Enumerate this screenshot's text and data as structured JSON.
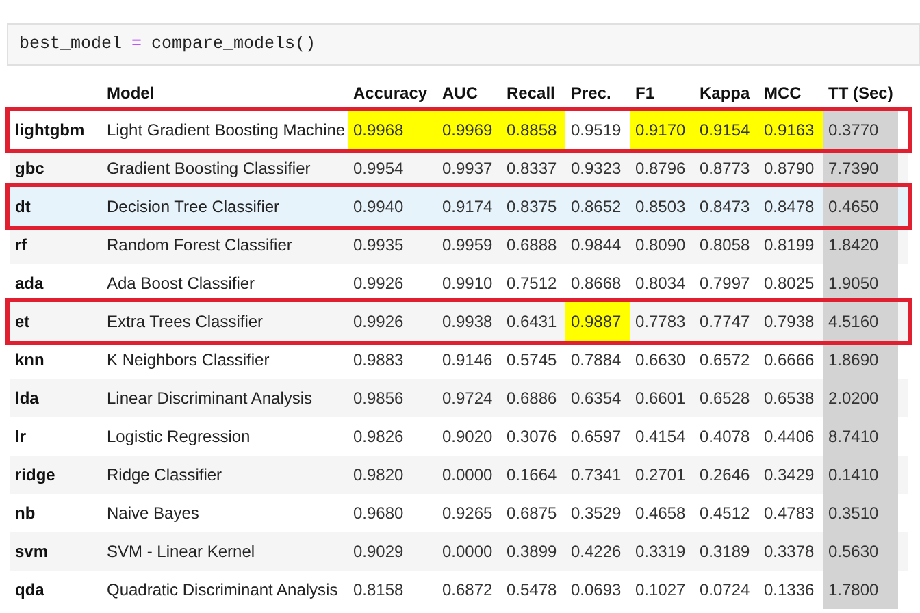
{
  "code_cell": {
    "tokens": [
      {
        "text": "best_model",
        "kind": "name"
      },
      {
        "text": "=",
        "kind": "operator"
      },
      {
        "text": "compare_models()",
        "kind": "name"
      }
    ]
  },
  "table": {
    "columns": [
      "",
      "Model",
      "Accuracy",
      "AUC",
      "Recall",
      "Prec.",
      "F1",
      "Kappa",
      "MCC",
      "TT (Sec)"
    ],
    "rows": [
      {
        "outlined": true,
        "hovered": false,
        "cells": [
          {
            "text": "lightgbm",
            "highlighted": false
          },
          {
            "text": "Light Gradient Boosting Machine",
            "highlighted": false
          },
          {
            "text": "0.9968",
            "highlighted": true
          },
          {
            "text": "0.9969",
            "highlighted": true
          },
          {
            "text": "0.8858",
            "highlighted": true
          },
          {
            "text": "0.9519",
            "highlighted": false
          },
          {
            "text": "0.9170",
            "highlighted": true
          },
          {
            "text": "0.9154",
            "highlighted": true
          },
          {
            "text": "0.9163",
            "highlighted": true
          },
          {
            "text": "0.3770",
            "highlighted": false
          }
        ]
      },
      {
        "outlined": false,
        "hovered": false,
        "cells": [
          {
            "text": "gbc",
            "highlighted": false
          },
          {
            "text": "Gradient Boosting Classifier",
            "highlighted": false
          },
          {
            "text": "0.9954",
            "highlighted": false
          },
          {
            "text": "0.9937",
            "highlighted": false
          },
          {
            "text": "0.8337",
            "highlighted": false
          },
          {
            "text": "0.9323",
            "highlighted": false
          },
          {
            "text": "0.8796",
            "highlighted": false
          },
          {
            "text": "0.8773",
            "highlighted": false
          },
          {
            "text": "0.8790",
            "highlighted": false
          },
          {
            "text": "7.7390",
            "highlighted": false
          }
        ]
      },
      {
        "outlined": true,
        "hovered": true,
        "cells": [
          {
            "text": "dt",
            "highlighted": false
          },
          {
            "text": "Decision Tree Classifier",
            "highlighted": false
          },
          {
            "text": "0.9940",
            "highlighted": false
          },
          {
            "text": "0.9174",
            "highlighted": false
          },
          {
            "text": "0.8375",
            "highlighted": false
          },
          {
            "text": "0.8652",
            "highlighted": false
          },
          {
            "text": "0.8503",
            "highlighted": false
          },
          {
            "text": "0.8473",
            "highlighted": false
          },
          {
            "text": "0.8478",
            "highlighted": false
          },
          {
            "text": "0.4650",
            "highlighted": false
          }
        ]
      },
      {
        "outlined": false,
        "hovered": false,
        "cells": [
          {
            "text": "rf",
            "highlighted": false
          },
          {
            "text": "Random Forest Classifier",
            "highlighted": false
          },
          {
            "text": "0.9935",
            "highlighted": false
          },
          {
            "text": "0.9959",
            "highlighted": false
          },
          {
            "text": "0.6888",
            "highlighted": false
          },
          {
            "text": "0.9844",
            "highlighted": false
          },
          {
            "text": "0.8090",
            "highlighted": false
          },
          {
            "text": "0.8058",
            "highlighted": false
          },
          {
            "text": "0.8199",
            "highlighted": false
          },
          {
            "text": "1.8420",
            "highlighted": false
          }
        ]
      },
      {
        "outlined": false,
        "hovered": false,
        "cells": [
          {
            "text": "ada",
            "highlighted": false
          },
          {
            "text": "Ada Boost Classifier",
            "highlighted": false
          },
          {
            "text": "0.9926",
            "highlighted": false
          },
          {
            "text": "0.9910",
            "highlighted": false
          },
          {
            "text": "0.7512",
            "highlighted": false
          },
          {
            "text": "0.8668",
            "highlighted": false
          },
          {
            "text": "0.8034",
            "highlighted": false
          },
          {
            "text": "0.7997",
            "highlighted": false
          },
          {
            "text": "0.8025",
            "highlighted": false
          },
          {
            "text": "1.9050",
            "highlighted": false
          }
        ]
      },
      {
        "outlined": true,
        "hovered": false,
        "cells": [
          {
            "text": "et",
            "highlighted": false
          },
          {
            "text": "Extra Trees Classifier",
            "highlighted": false
          },
          {
            "text": "0.9926",
            "highlighted": false
          },
          {
            "text": "0.9938",
            "highlighted": false
          },
          {
            "text": "0.6431",
            "highlighted": false
          },
          {
            "text": "0.9887",
            "highlighted": true
          },
          {
            "text": "0.7783",
            "highlighted": false
          },
          {
            "text": "0.7747",
            "highlighted": false
          },
          {
            "text": "0.7938",
            "highlighted": false
          },
          {
            "text": "4.5160",
            "highlighted": false
          }
        ]
      },
      {
        "outlined": false,
        "hovered": false,
        "cells": [
          {
            "text": "knn",
            "highlighted": false
          },
          {
            "text": "K Neighbors Classifier",
            "highlighted": false
          },
          {
            "text": "0.9883",
            "highlighted": false
          },
          {
            "text": "0.9146",
            "highlighted": false
          },
          {
            "text": "0.5745",
            "highlighted": false
          },
          {
            "text": "0.7884",
            "highlighted": false
          },
          {
            "text": "0.6630",
            "highlighted": false
          },
          {
            "text": "0.6572",
            "highlighted": false
          },
          {
            "text": "0.6666",
            "highlighted": false
          },
          {
            "text": "1.8690",
            "highlighted": false
          }
        ]
      },
      {
        "outlined": false,
        "hovered": false,
        "cells": [
          {
            "text": "lda",
            "highlighted": false
          },
          {
            "text": "Linear Discriminant Analysis",
            "highlighted": false
          },
          {
            "text": "0.9856",
            "highlighted": false
          },
          {
            "text": "0.9724",
            "highlighted": false
          },
          {
            "text": "0.6886",
            "highlighted": false
          },
          {
            "text": "0.6354",
            "highlighted": false
          },
          {
            "text": "0.6601",
            "highlighted": false
          },
          {
            "text": "0.6528",
            "highlighted": false
          },
          {
            "text": "0.6538",
            "highlighted": false
          },
          {
            "text": "2.0200",
            "highlighted": false
          }
        ]
      },
      {
        "outlined": false,
        "hovered": false,
        "cells": [
          {
            "text": "lr",
            "highlighted": false
          },
          {
            "text": "Logistic Regression",
            "highlighted": false
          },
          {
            "text": "0.9826",
            "highlighted": false
          },
          {
            "text": "0.9020",
            "highlighted": false
          },
          {
            "text": "0.3076",
            "highlighted": false
          },
          {
            "text": "0.6597",
            "highlighted": false
          },
          {
            "text": "0.4154",
            "highlighted": false
          },
          {
            "text": "0.4078",
            "highlighted": false
          },
          {
            "text": "0.4406",
            "highlighted": false
          },
          {
            "text": "8.7410",
            "highlighted": false
          }
        ]
      },
      {
        "outlined": false,
        "hovered": false,
        "cells": [
          {
            "text": "ridge",
            "highlighted": false
          },
          {
            "text": "Ridge Classifier",
            "highlighted": false
          },
          {
            "text": "0.9820",
            "highlighted": false
          },
          {
            "text": "0.0000",
            "highlighted": false
          },
          {
            "text": "0.1664",
            "highlighted": false
          },
          {
            "text": "0.7341",
            "highlighted": false
          },
          {
            "text": "0.2701",
            "highlighted": false
          },
          {
            "text": "0.2646",
            "highlighted": false
          },
          {
            "text": "0.3429",
            "highlighted": false
          },
          {
            "text": "0.1410",
            "highlighted": false
          }
        ]
      },
      {
        "outlined": false,
        "hovered": false,
        "cells": [
          {
            "text": "nb",
            "highlighted": false
          },
          {
            "text": "Naive Bayes",
            "highlighted": false
          },
          {
            "text": "0.9680",
            "highlighted": false
          },
          {
            "text": "0.9265",
            "highlighted": false
          },
          {
            "text": "0.6875",
            "highlighted": false
          },
          {
            "text": "0.3529",
            "highlighted": false
          },
          {
            "text": "0.4658",
            "highlighted": false
          },
          {
            "text": "0.4512",
            "highlighted": false
          },
          {
            "text": "0.4783",
            "highlighted": false
          },
          {
            "text": "0.3510",
            "highlighted": false
          }
        ]
      },
      {
        "outlined": false,
        "hovered": false,
        "cells": [
          {
            "text": "svm",
            "highlighted": false
          },
          {
            "text": "SVM - Linear Kernel",
            "highlighted": false
          },
          {
            "text": "0.9029",
            "highlighted": false
          },
          {
            "text": "0.0000",
            "highlighted": false
          },
          {
            "text": "0.3899",
            "highlighted": false
          },
          {
            "text": "0.4226",
            "highlighted": false
          },
          {
            "text": "0.3319",
            "highlighted": false
          },
          {
            "text": "0.3189",
            "highlighted": false
          },
          {
            "text": "0.3378",
            "highlighted": false
          },
          {
            "text": "0.5630",
            "highlighted": false
          }
        ]
      },
      {
        "outlined": false,
        "hovered": false,
        "cells": [
          {
            "text": "qda",
            "highlighted": false
          },
          {
            "text": "Quadratic Discriminant Analysis",
            "highlighted": false
          },
          {
            "text": "0.8158",
            "highlighted": false
          },
          {
            "text": "0.6872",
            "highlighted": false
          },
          {
            "text": "0.5478",
            "highlighted": false
          },
          {
            "text": "0.0693",
            "highlighted": false
          },
          {
            "text": "0.1027",
            "highlighted": false
          },
          {
            "text": "0.0724",
            "highlighted": false
          },
          {
            "text": "0.1336",
            "highlighted": false
          },
          {
            "text": "1.7800",
            "highlighted": false
          }
        ]
      }
    ]
  }
}
